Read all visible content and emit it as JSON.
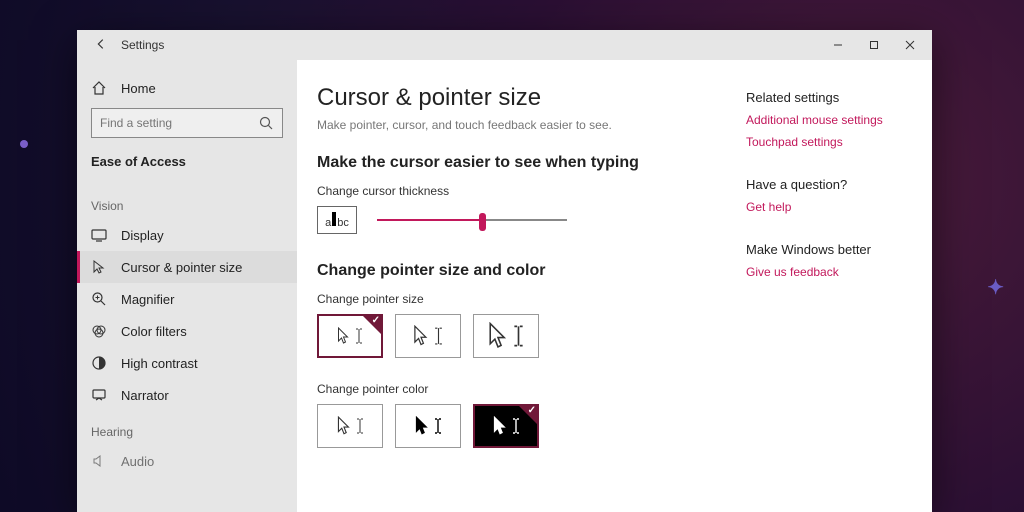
{
  "colors": {
    "accent": "#c2185b"
  },
  "window": {
    "title": "Settings"
  },
  "sidebar": {
    "home": "Home",
    "search_placeholder": "Find a setting",
    "category": "Ease of Access",
    "groups": [
      {
        "label": "Vision",
        "items": [
          {
            "id": "display",
            "label": "Display"
          },
          {
            "id": "cursor-pointer",
            "label": "Cursor & pointer size",
            "selected": true
          },
          {
            "id": "magnifier",
            "label": "Magnifier"
          },
          {
            "id": "color-filters",
            "label": "Color filters"
          },
          {
            "id": "high-contrast",
            "label": "High contrast"
          },
          {
            "id": "narrator",
            "label": "Narrator"
          }
        ]
      },
      {
        "label": "Hearing",
        "items": [
          {
            "id": "audio",
            "label": "Audio"
          }
        ]
      }
    ]
  },
  "page": {
    "title": "Cursor & pointer size",
    "subtitle": "Make pointer, cursor, and touch feedback easier to see.",
    "section1": {
      "title": "Make the cursor easier to see when typing",
      "thickness_label": "Change cursor thickness",
      "preview_text": "abc",
      "slider_percent": 55
    },
    "section2": {
      "title": "Change pointer size and color",
      "size_label": "Change pointer size",
      "size_options": [
        "small",
        "medium",
        "large"
      ],
      "size_selected": 0,
      "color_label": "Change pointer color",
      "color_options": [
        "white",
        "black",
        "inverted"
      ],
      "color_selected": 2
    }
  },
  "rail": {
    "related_heading": "Related settings",
    "related_links": [
      "Additional mouse settings",
      "Touchpad settings"
    ],
    "question_heading": "Have a question?",
    "question_link": "Get help",
    "feedback_heading": "Make Windows better",
    "feedback_link": "Give us feedback"
  }
}
